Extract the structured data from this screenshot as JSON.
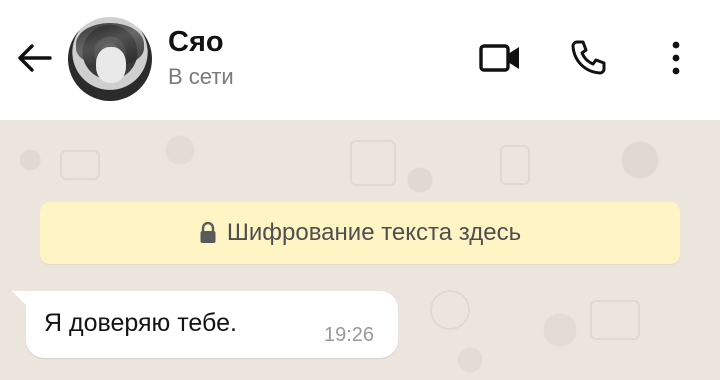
{
  "header": {
    "contact_name": "Сяо",
    "status": "В сети",
    "icons": {
      "back": "arrow-left-icon",
      "video": "video-camera-icon",
      "call": "phone-icon",
      "menu": "more-vertical-icon"
    }
  },
  "chat": {
    "encryption_notice": "Шифрование текста здесь",
    "encryption_icon": "lock-icon",
    "messages": [
      {
        "text": "Я доверяю тебе.",
        "time": "19:26",
        "direction": "incoming"
      }
    ]
  },
  "colors": {
    "header_bg": "#ffffff",
    "chat_bg": "#ece5dd",
    "notice_bg": "#fff5c4",
    "bubble_bg": "#ffffff"
  }
}
